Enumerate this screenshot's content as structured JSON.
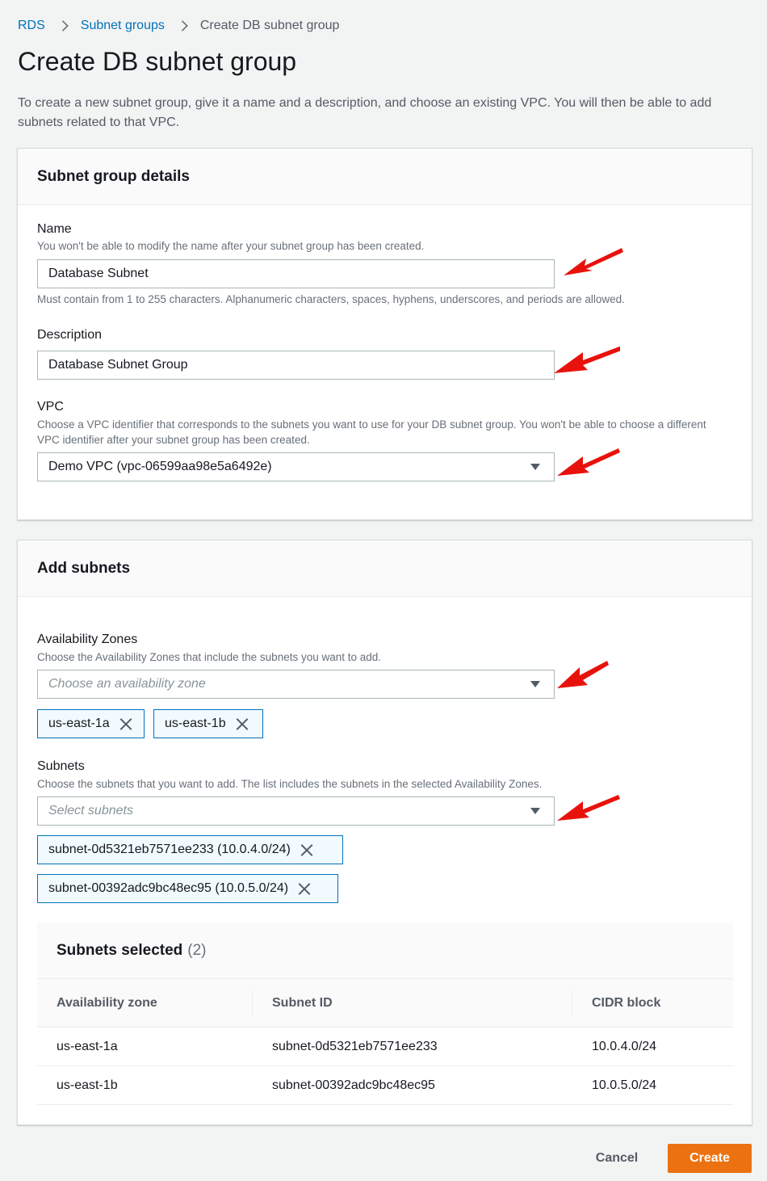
{
  "breadcrumb": {
    "rds": "RDS",
    "subnet_groups": "Subnet groups",
    "current": "Create DB subnet group"
  },
  "page": {
    "title": "Create DB subnet group",
    "description": "To create a new subnet group, give it a name and a description, and choose an existing VPC. You will then be able to add subnets related to that VPC."
  },
  "details": {
    "header": "Subnet group details",
    "name": {
      "label": "Name",
      "hint": "You won't be able to modify the name after your subnet group has been created.",
      "value": "Database Subnet",
      "constraint": "Must contain from 1 to 255 characters. Alphanumeric characters, spaces, hyphens, underscores, and periods are allowed."
    },
    "description": {
      "label": "Description",
      "value": "Database Subnet Group"
    },
    "vpc": {
      "label": "VPC",
      "hint": "Choose a VPC identifier that corresponds to the subnets you want to use for your DB subnet group. You won't be able to choose a different VPC identifier after your subnet group has been created.",
      "value": "Demo VPC (vpc-06599aa98e5a6492e)"
    }
  },
  "add_subnets": {
    "header": "Add subnets",
    "az": {
      "label": "Availability Zones",
      "hint": "Choose the Availability Zones that include the subnets you want to add.",
      "placeholder": "Choose an availability zone",
      "tokens": [
        "us-east-1a",
        "us-east-1b"
      ]
    },
    "subnets": {
      "label": "Subnets",
      "hint": "Choose the subnets that you want to add. The list includes the subnets in the selected Availability Zones.",
      "placeholder": "Select subnets",
      "tokens": [
        "subnet-0d5321eb7571ee233 (10.0.4.0/24)",
        "subnet-00392adc9bc48ec95 (10.0.5.0/24)"
      ]
    },
    "selected": {
      "title": "Subnets selected",
      "count": "(2)",
      "columns": [
        "Availability zone",
        "Subnet ID",
        "CIDR block"
      ],
      "rows": [
        [
          "us-east-1a",
          "subnet-0d5321eb7571ee233",
          "10.0.4.0/24"
        ],
        [
          "us-east-1b",
          "subnet-00392adc9bc48ec95",
          "10.0.5.0/24"
        ]
      ]
    }
  },
  "footer": {
    "cancel": "Cancel",
    "create": "Create"
  },
  "colors": {
    "annotation_arrow": "#e8120c",
    "primary_button": "#ec7211",
    "link": "#0073bb"
  }
}
